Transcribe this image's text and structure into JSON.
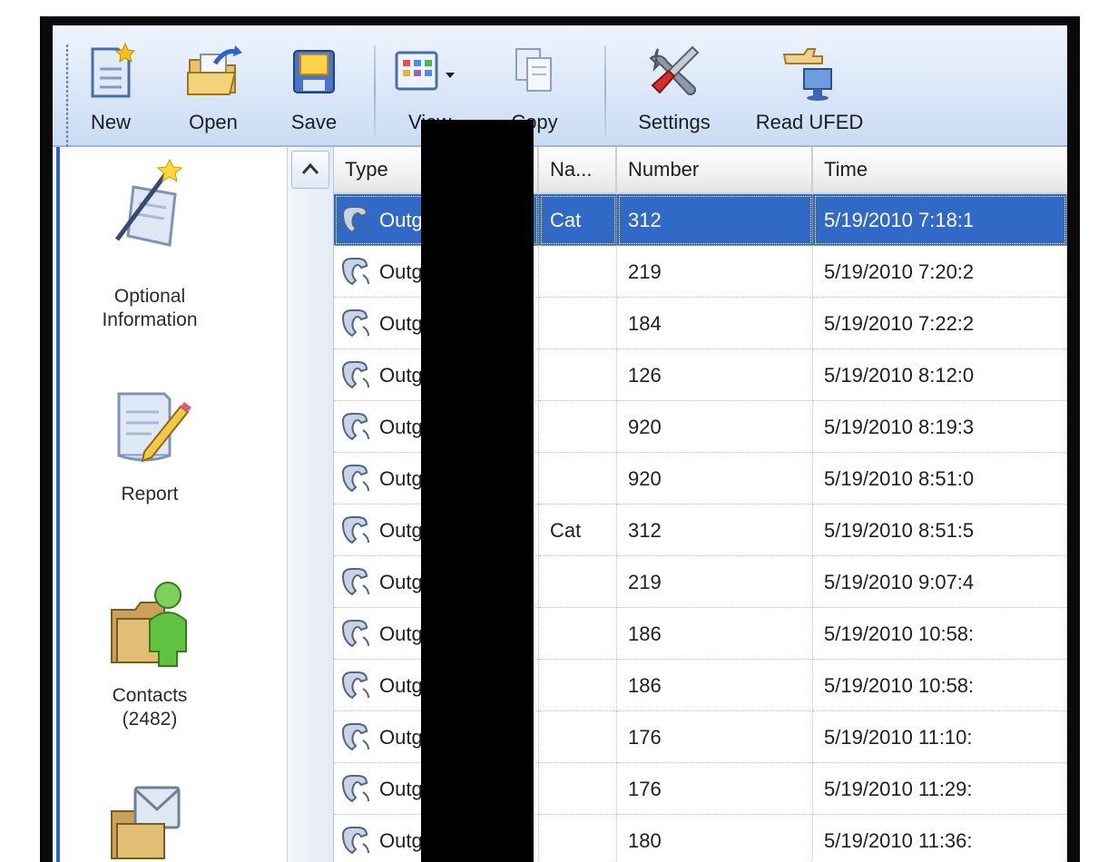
{
  "toolbar": {
    "buttons": [
      {
        "label": "New",
        "icon": "new-document-icon"
      },
      {
        "label": "Open",
        "icon": "open-folder-icon"
      },
      {
        "label": "Save",
        "icon": "save-disk-icon"
      },
      {
        "label": "View",
        "icon": "view-grid-icon"
      },
      {
        "label": "Copy",
        "icon": "copy-icon"
      },
      {
        "label": "Settings",
        "icon": "wrench-screwdriver-icon"
      },
      {
        "label": "Read UFED",
        "icon": "read-ufed-icon"
      }
    ]
  },
  "nav": {
    "items": [
      {
        "label_line1": "Optional",
        "label_line2": "Information",
        "icon": "magic-wand-icon"
      },
      {
        "label_line1": "Report",
        "label_line2": "",
        "icon": "report-pencil-icon"
      },
      {
        "label_line1": "Contacts",
        "label_line2": "(2482)",
        "icon": "contacts-icon"
      },
      {
        "label_line1": "",
        "label_line2": "",
        "icon": "sms-envelope-icon"
      }
    ]
  },
  "grid": {
    "columns": {
      "type": "Type",
      "name": "Na...",
      "number": "Number",
      "time": "Time"
    },
    "rows": [
      {
        "type": "Outgoing",
        "name": "Cat",
        "number": "312",
        "time": "5/19/2010 7:18:1",
        "selected": true
      },
      {
        "type": "Outgoing",
        "name": "",
        "number": "219",
        "time": "5/19/2010 7:20:2",
        "selected": false
      },
      {
        "type": "Outgoing",
        "name": "",
        "number": "184",
        "time": "5/19/2010 7:22:2",
        "selected": false
      },
      {
        "type": "Outgoing",
        "name": "",
        "number": "126",
        "time": "5/19/2010 8:12:0",
        "selected": false
      },
      {
        "type": "Outgoing",
        "name": "",
        "number": "920",
        "time": "5/19/2010 8:19:3",
        "selected": false
      },
      {
        "type": "Outgoing",
        "name": "",
        "number": "920",
        "time": "5/19/2010 8:51:0",
        "selected": false
      },
      {
        "type": "Outgoing",
        "name": "Cat",
        "number": "312",
        "time": "5/19/2010 8:51:5",
        "selected": false
      },
      {
        "type": "Outgoing",
        "name": "",
        "number": "219",
        "time": "5/19/2010 9:07:4",
        "selected": false
      },
      {
        "type": "Outgoing",
        "name": "",
        "number": "186",
        "time": "5/19/2010 10:58:",
        "selected": false
      },
      {
        "type": "Outgoing",
        "name": "",
        "number": "186",
        "time": "5/19/2010 10:58:",
        "selected": false
      },
      {
        "type": "Outgoing",
        "name": "",
        "number": "176",
        "time": "5/19/2010 11:10:",
        "selected": false
      },
      {
        "type": "Outgoing",
        "name": "",
        "number": "176",
        "time": "5/19/2010 11:29:",
        "selected": false
      },
      {
        "type": "Outgoing",
        "name": "",
        "number": "180",
        "time": "5/19/2010 11:36:",
        "selected": false
      }
    ]
  },
  "colors": {
    "selection": "#3169c6",
    "toolbar_top": "#eef4fd",
    "toolbar_bottom": "#c9dbf4",
    "redaction": "#000000"
  }
}
